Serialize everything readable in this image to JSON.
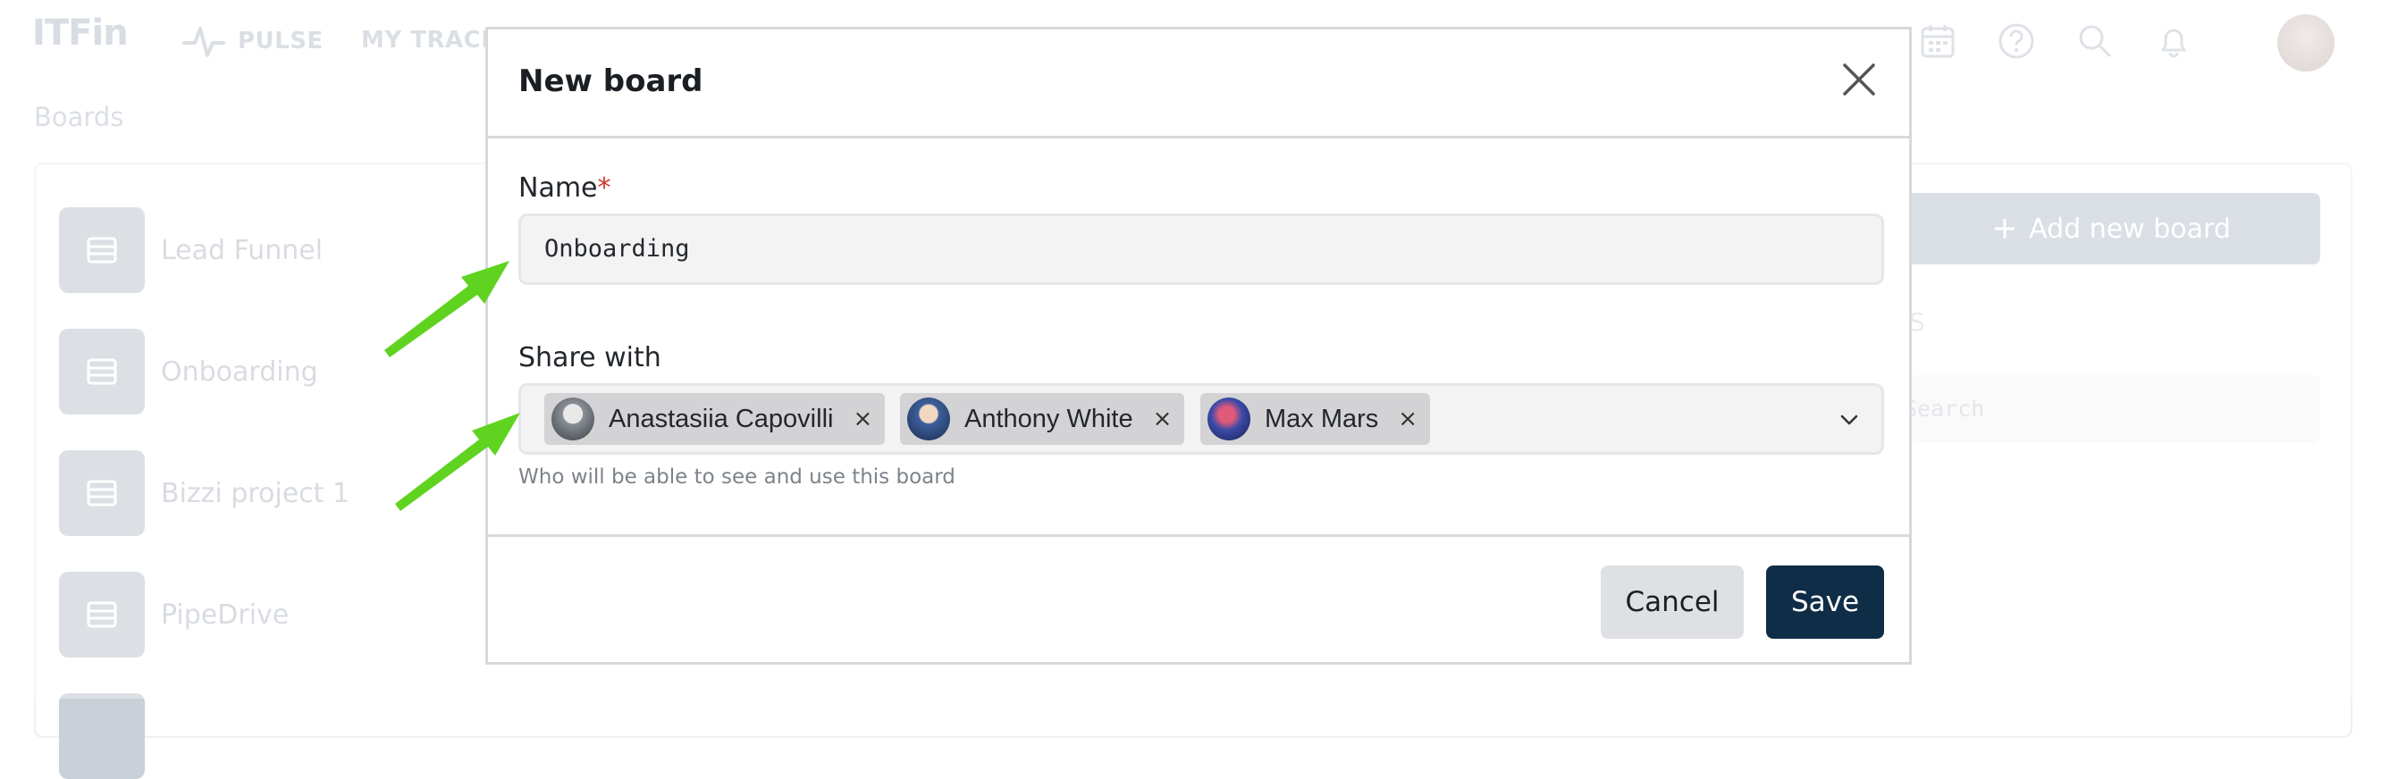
{
  "app": {
    "logo": "ITFin"
  },
  "nav": {
    "pulse_label": "PULSE",
    "tracker_label": "MY TRACKE"
  },
  "page": {
    "title": "Boards"
  },
  "boards": [
    {
      "label": "Lead Funnel"
    },
    {
      "label": "Onboarding"
    },
    {
      "label": "Bizzi project 1"
    },
    {
      "label": "PipeDrive"
    }
  ],
  "right_panel": {
    "add_button_label": "Add new board",
    "section_fragment": "S",
    "search_placeholder": "Search"
  },
  "modal": {
    "title": "New board",
    "name_label": "Name",
    "required_mark": "*",
    "name_value": "Onboarding",
    "share_label": "Share with",
    "shared_users": [
      {
        "name": "Anastasiia Capovilli",
        "remove": "×"
      },
      {
        "name": "Anthony White",
        "remove": "×"
      },
      {
        "name": "Max Mars",
        "remove": "×"
      }
    ],
    "share_help": "Who will be able to see and use this board",
    "cancel_label": "Cancel",
    "save_label": "Save"
  },
  "colors": {
    "primary": "#0f2d47",
    "arrow": "#5fd320",
    "required": "#d4322b"
  },
  "icons": [
    "pulse-icon",
    "calendar-icon",
    "help-icon",
    "search-icon",
    "bell-icon",
    "close-icon",
    "chevron-down-icon",
    "board-icon"
  ]
}
